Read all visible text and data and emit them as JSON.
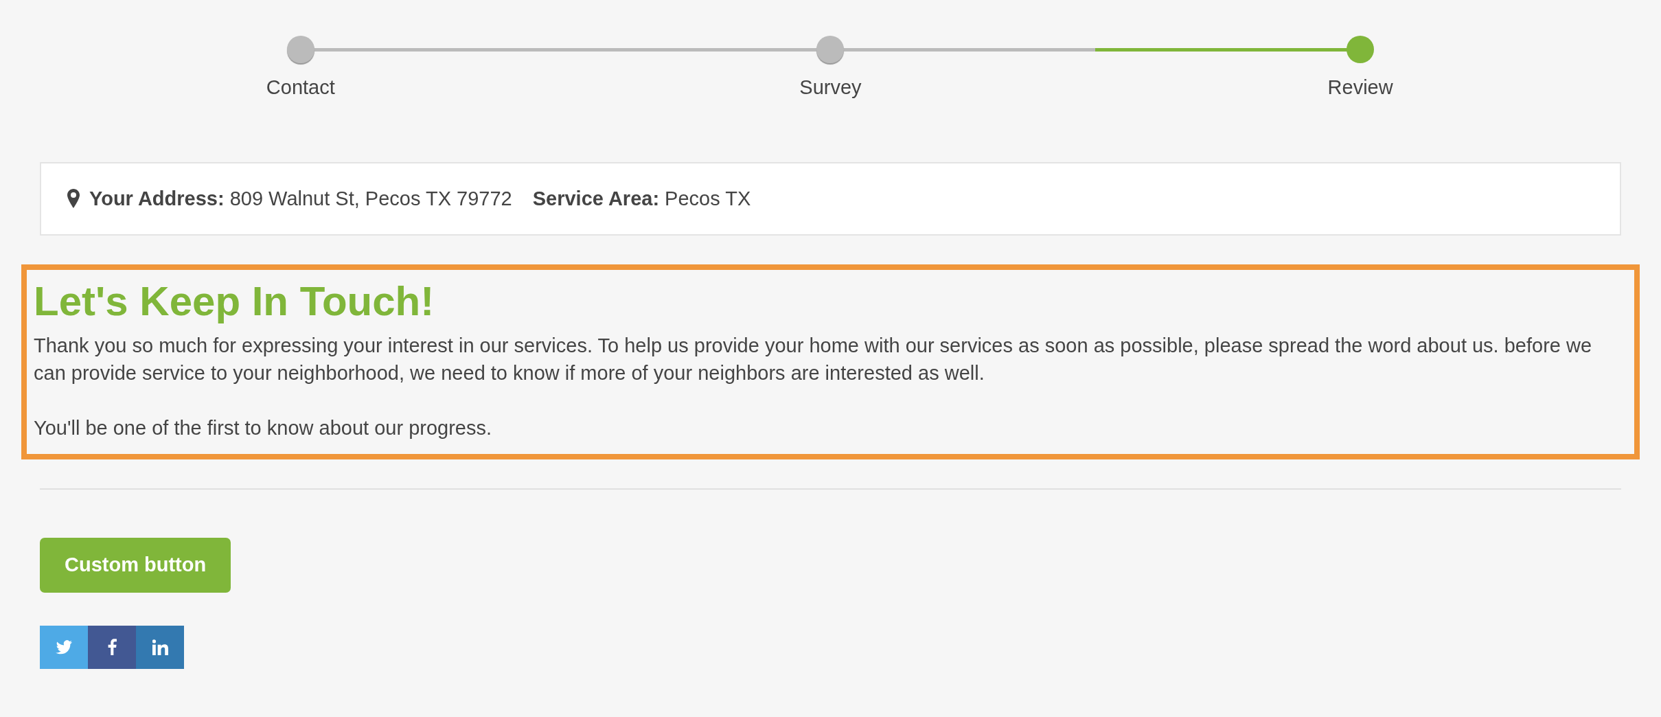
{
  "steps": [
    {
      "label": "Contact",
      "selected": false
    },
    {
      "label": "Survey",
      "selected": false
    },
    {
      "label": "Review",
      "selected": true
    }
  ],
  "location": {
    "address": "**Your Address:** 809 Walnut St, Pecos TX 79772",
    "service_area": "**Service Area:** Pecos TX"
  },
  "message": {
    "title": "Let's Keep In Touch!",
    "paragraphs": [
      "Thank you so much for expressing your interest in our services. To help us provide your home with our services as soon as possible, please spread the word about us. before we can provide service to your neighborhood, we need to know if more of your neighbors are interested as well.",
      "You'll be one of the first to know about our progress."
    ]
  },
  "button": "Custom button",
  "social": [
    {
      "kind": "twitter"
    },
    {
      "kind": "facebook"
    },
    {
      "kind": "linkedin"
    }
  ]
}
